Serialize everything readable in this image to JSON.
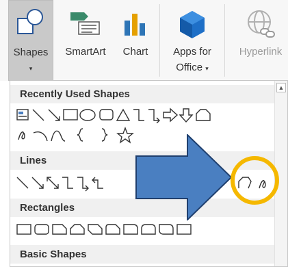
{
  "ribbon": {
    "shapes_label": "Shapes",
    "smartart_label": "SmartArt",
    "chart_label": "Chart",
    "apps_label_line1": "Apps for",
    "apps_label_line2": "Office",
    "hyperlink_label": "Hyperlink",
    "caret": "▾"
  },
  "gallery": {
    "sections": [
      {
        "title": "Recently Used Shapes"
      },
      {
        "title": "Lines"
      },
      {
        "title": "Rectangles"
      },
      {
        "title": "Basic Shapes"
      }
    ]
  },
  "colors": {
    "arrow_fill": "#4a7fc1",
    "arrow_stroke": "#1f3f6e",
    "highlight_circle": "#f5b800"
  },
  "icons": [
    "shapes-icon",
    "smartart-icon",
    "chart-icon",
    "apps-for-office-icon",
    "hyperlink-icon",
    "scroll-up-icon"
  ]
}
